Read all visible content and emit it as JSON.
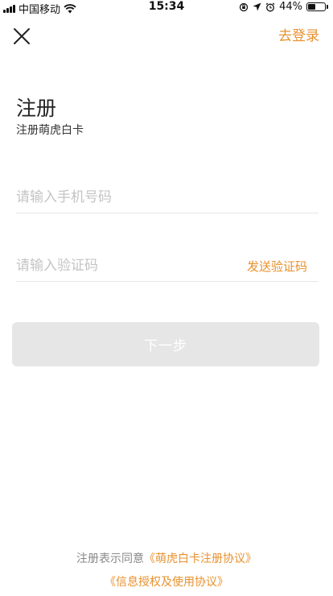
{
  "status_bar": {
    "carrier": "中国移动",
    "time": "15:34",
    "battery": "44%",
    "battery_level": 0.44,
    "icons": [
      "signal-icon",
      "wifi-icon",
      "orientation-lock-icon",
      "location-icon",
      "alarm-icon",
      "battery-icon"
    ]
  },
  "header": {
    "close_icon": "close-icon",
    "login_label": "去登录"
  },
  "page": {
    "title": "注册",
    "subtitle": "注册萌虎白卡"
  },
  "form": {
    "phone_placeholder": "请输入手机号码",
    "code_placeholder": "请输入验证码",
    "send_code_label": "发送验证码",
    "next_label": "下一步"
  },
  "agreement": {
    "prefix": "注册表示同意",
    "link1": "《萌虎白卡注册协议》",
    "link2": "《信息授权及使用协议》"
  },
  "colors": {
    "accent": "#e8912e",
    "button_disabled": "#e6e6e6",
    "placeholder": "#c4c4c4"
  }
}
